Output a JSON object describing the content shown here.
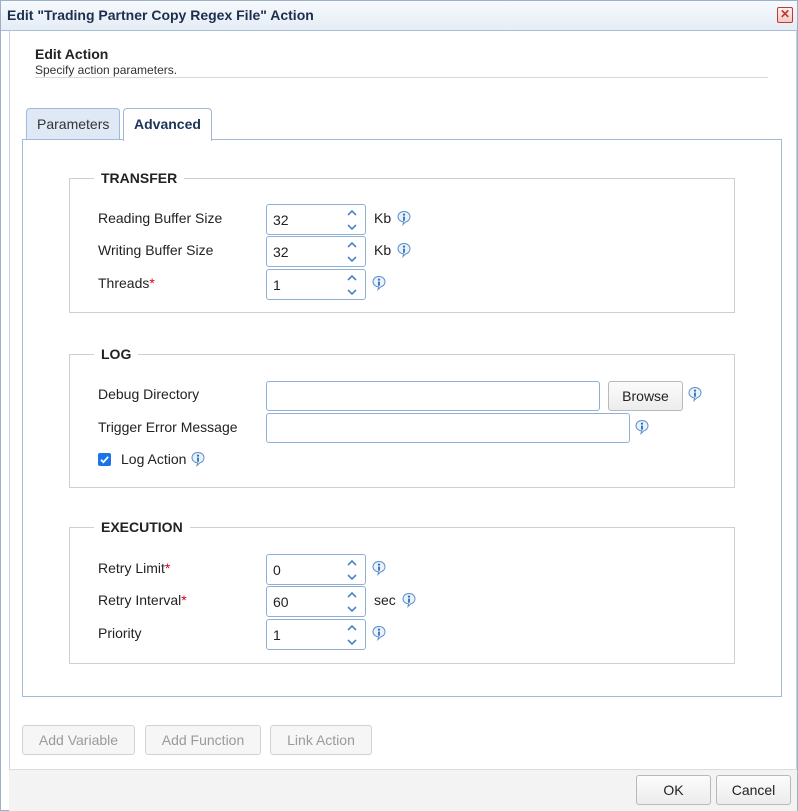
{
  "window": {
    "title": "Edit \"Trading Partner Copy Regex File\" Action",
    "close_glyph": "✕"
  },
  "header": {
    "title": "Edit Action",
    "subtitle": "Specify action parameters."
  },
  "tabs": [
    {
      "label": "Parameters",
      "active": false
    },
    {
      "label": "Advanced",
      "active": true
    }
  ],
  "transfer": {
    "legend": "TRANSFER",
    "reading_buffer": {
      "label": "Reading Buffer Size",
      "value": "32",
      "unit": "Kb"
    },
    "writing_buffer": {
      "label": "Writing Buffer Size",
      "value": "32",
      "unit": "Kb"
    },
    "threads": {
      "label": "Threads",
      "required_mark": "*",
      "value": "1"
    }
  },
  "log": {
    "legend": "LOG",
    "debug_directory": {
      "label": "Debug Directory",
      "value": "",
      "browse_label": "Browse"
    },
    "trigger_error": {
      "label": "Trigger Error Message",
      "value": ""
    },
    "log_action": {
      "label": "Log Action",
      "checked": true
    }
  },
  "execution": {
    "legend": "EXECUTION",
    "retry_limit": {
      "label": "Retry Limit",
      "required_mark": "*",
      "value": "0"
    },
    "retry_interval": {
      "label": "Retry Interval",
      "required_mark": "*",
      "value": "60",
      "unit": "sec"
    },
    "priority": {
      "label": "Priority",
      "value": "1"
    }
  },
  "actions": {
    "add_variable": "Add Variable",
    "add_function": "Add Function",
    "link_action": "Link Action"
  },
  "footer": {
    "ok": "OK",
    "cancel": "Cancel"
  },
  "colors": {
    "accent": "#1a73e8",
    "required": "#d0021b",
    "border": "#8fb0d4"
  }
}
